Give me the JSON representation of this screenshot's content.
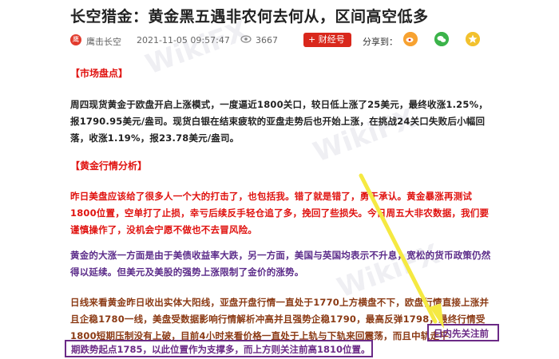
{
  "article": {
    "title": "长空猎金：黄金黑五遇非农何去何从，区间高空低多",
    "author": "鹰击长空",
    "author_avatar_text": "鹰",
    "date": "2021-11-05 09:57:47",
    "views": "3667",
    "follow_label": "+ 财经号",
    "share_label": "分享到："
  },
  "sections": [
    {
      "heading": "【市场盘点】",
      "paragraphs": [
        "周四现货黄金于欧盘开启上涨模式，一度逼近1800关口，较日低上涨了25美元，最终收涨1.25%，报1790.95美元/盎司。现货白银在结束疲软的亚盘走势后也开始上涨，在挑战24关口失败后小幅回落，收涨1.19%，报23.78美元/盎司。"
      ]
    },
    {
      "heading": "【黄金行情分析】",
      "paragraphs": [
        "昨日美盘应该给了很多人一个大的打击了，也包括我。错了就是错了，勇于承认。黄金暴涨再测试1800位置，空单打了止损，幸亏后续反手轻仓追了多，挽回了些损失。今日周五大非农数据，我们要谨慎操作了，没机会宁愿不做也不去冒风险。",
        "黄金的大涨一方面是由于美债收益率大跌，另一方面，美国与英国均表示不升息，宽松的货币政策仍然得以延续。但美元及美股的强势上涨限制了金价的涨势。",
        "日线来看黄金昨日收出实体大阳线，亚盘开盘行情一直处于1770上方横盘不下，欧盘行情直接上涨并且企稳1780一线，美盘受数据影响行情解析冲高并且强势企稳1790，最高反弹1798，最终行情受1800短期压制没有上破，目前4小时来看价格一直处于上轨与下轨来回震荡，而且中轨走平"
      ]
    }
  ],
  "highlights": {
    "box1": "日内先关注前",
    "box2": "期跌势起点1785，以此位置作为支撑多，而上方则关注前高1810位置。"
  },
  "watermark": "WikiFX",
  "colors": {
    "brand_red": "#d9281c",
    "heading_red": "#e0120f",
    "highlight_purple": "#6b2a86",
    "arrow_yellow": "#f5e942"
  }
}
